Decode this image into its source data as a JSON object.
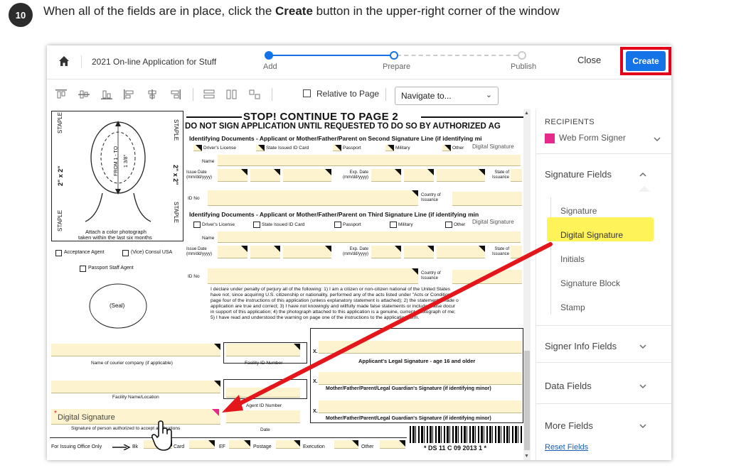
{
  "step": {
    "number": "10",
    "text_before": "When all of the fields are in place, click the ",
    "text_bold": "Create",
    "text_after": " button in the upper-right corner of the window"
  },
  "window": {
    "doc_title": "2021 On-line Application for Stuff",
    "progress": {
      "steps": [
        "Add",
        "Prepare",
        "Publish"
      ],
      "current_step": "Prepare"
    },
    "close_label": "Close",
    "create_label": "Create"
  },
  "toolbar": {
    "relative_label": "Relative to Page",
    "navigate_value": "Navigate to..."
  },
  "form": {
    "header": "STOP! CONTINUE TO PAGE 2",
    "warning": "DO NOT SIGN APPLICATION UNTIL REQUESTED TO DO SO BY AUTHORIZED AG",
    "id_docs_second": "Identifying Documents - Applicant or Mother/Father/Parent on Second Signature Line (if identifying mi",
    "id_docs_third": "Identifying Documents - Applicant or Mother/Father/Parent on Third Signature Line (if identifying min",
    "drivers_license": "Driver's License",
    "state_id_card": "State Issued ID Card",
    "passport": "Passport",
    "military": "Military",
    "other": "Other",
    "digital_signature_small": "Digital Signature",
    "name": "Name",
    "issue_date": "Issue Date (mm/dd/yyyy)",
    "exp_date": "Exp. Date (mm/dd/yyyy)",
    "state_of_issuance": "State of Issuance",
    "id_no": "ID No",
    "country_of_issuance": "Country of Issuance",
    "staple": "STAPLE",
    "size": "2\" x 2\"",
    "from_1_to": "FROM 1 - TO",
    "size_measure": "1 3/8\"",
    "photo_caption_1": "Attach a color photograph",
    "photo_caption_2": "taken within the last six months",
    "acceptance_agent": "Acceptance Agent",
    "vice_consul": "(Vice) Consul USA",
    "passport_staff_agent": "Passport Staff Agent",
    "seal": "(Seal)",
    "declaration": [
      "I declare under penalty of perjury all of the following: 1) I am a citizen or non-citizen national of the United States",
      "have not, since acquiring U.S. citizenship or nationality, performed any of the acts listed under \"Acts or Condition",
      "page four of the instructions of this application (unless explanatory statement is attached); 2) the statements made o",
      "application are true and correct; 3) I have not knowingly and willfully made false statements or included false docur",
      "in support of this application; 4) the photograph attached to this application is a genuine, current photograph of me;",
      "5) I have read and understood the warning on page one of the instructions to the application form."
    ],
    "courier_company": "Name of courier company (if applicable)",
    "facility_id": "Facility ID Number",
    "facility_name": "Facility Name/Location",
    "agent_id": "Agent ID Number",
    "digital_signature_field": "Digital Signature",
    "signature_authorized": "Signature of person authorized to accept applications",
    "date": "Date",
    "applicant_signature": "Applicant's Legal Signature - age 16 and older",
    "guardian_signature_1": "Mother/Father/Parent/Legal Guardian's Signature (if identifying minor)",
    "guardian_signature_2": "Mother/Father/Parent/Legal Guardian's Signature (if identifying minor)",
    "x_mark": "X.",
    "for_issuing": "For Issuing Office Only",
    "bk": "Bk",
    "card": "Card",
    "ef": "EF",
    "postage": "Postage",
    "execution": "Execution",
    "other_fee": "Other",
    "barcode_text": "* DS 11 C 09 2013 1 *"
  },
  "panel": {
    "recipients_label": "RECIPIENTS",
    "recipient_name": "Web Form Signer",
    "recipient_color": "#e8298c",
    "signature_fields_label": "Signature Fields",
    "signature_options": [
      "Signature",
      "Digital Signature",
      "Initials",
      "Signature Block",
      "Stamp"
    ],
    "highlighted_option": "Digital Signature",
    "signer_info_label": "Signer Info Fields",
    "data_fields_label": "Data Fields",
    "more_fields_label": "More Fields",
    "reset_fields_label": "Reset Fields"
  },
  "colors": {
    "accent": "#1473e6",
    "highlight_outline": "#e3001b",
    "field_fill": "#fdf4cf",
    "option_highlight": "#fff35a",
    "arrow": "#e3161b"
  },
  "icons": [
    "home-icon",
    "chevron-down-icon",
    "chevron-up-icon",
    "checkbox-icon",
    "hand-cursor-icon",
    "drag-arrow-icon"
  ]
}
